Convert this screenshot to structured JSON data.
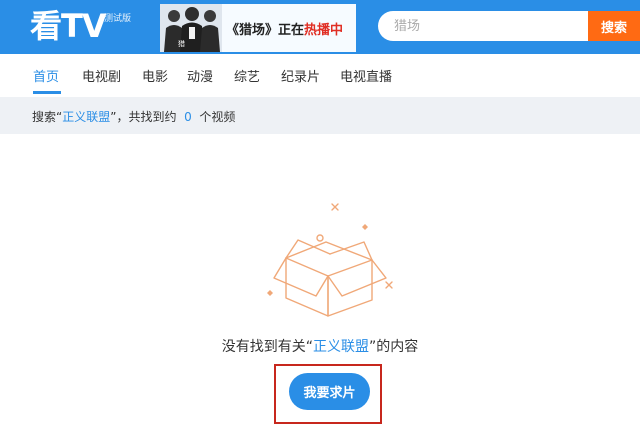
{
  "header": {
    "logo": "看TV",
    "logo_badge": "测试版",
    "banner": {
      "prefix": "《猎场》正在",
      "highlight": "热播中"
    },
    "search": {
      "placeholder": "猎场",
      "button_label": "搜索"
    }
  },
  "nav": {
    "items": [
      {
        "label": "首页"
      },
      {
        "label": "电视剧"
      },
      {
        "label": "电影"
      },
      {
        "label": "动漫"
      },
      {
        "label": "综艺"
      },
      {
        "label": "纪录片"
      },
      {
        "label": "电视直播"
      }
    ],
    "active_index": 0
  },
  "results": {
    "prefix": "搜索“",
    "keyword": "正义联盟",
    "middle": "”，共找到约",
    "count": "0",
    "suffix": "个视频"
  },
  "empty_state": {
    "message_prefix": "没有找到有关“",
    "keyword": "正义联盟",
    "message_suffix": "”的内容",
    "request_button_label": "我要求片",
    "illustration_icon": "empty-box-icon"
  },
  "colors": {
    "brand_blue": "#2a8ee6",
    "search_orange": "#ff6a13",
    "result_bar_bg": "#eef1f5",
    "illustration_orange": "#f0a878",
    "highlight_frame": "#c7271d",
    "banner_highlight": "#e02e24"
  }
}
